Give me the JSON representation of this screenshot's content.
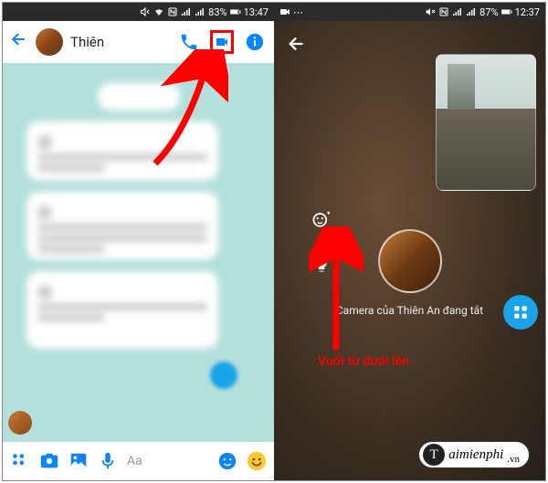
{
  "left": {
    "status": {
      "battery": "83%",
      "time": "13:47"
    },
    "contact_name": "Thiên",
    "composer_placeholder": "Aa"
  },
  "right": {
    "status": {
      "battery": "87%",
      "time": "12:37"
    },
    "camera_off_text": "Camera của Thiên An đang tắt"
  },
  "instruction": "Vuốt từ dưới lên",
  "watermark": {
    "t": "T",
    "brand": "aimienphi",
    "tld": ".vn"
  }
}
